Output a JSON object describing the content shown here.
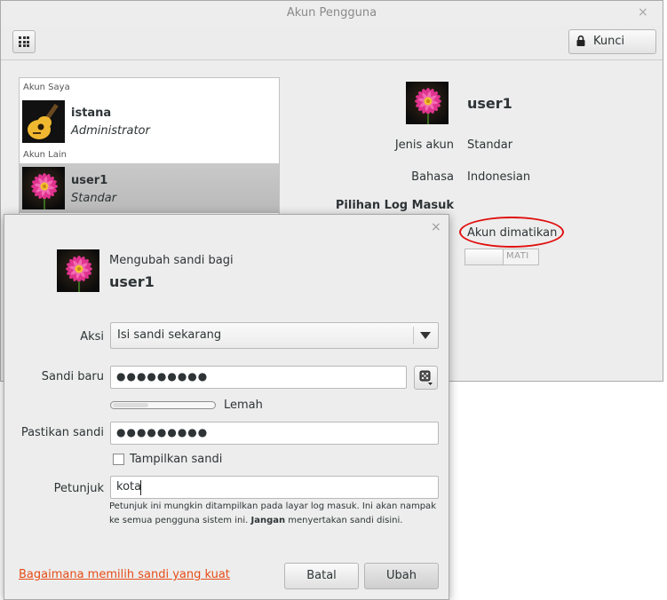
{
  "window": {
    "title": "Akun Pengguna",
    "close_glyph": "×",
    "apps_icon": "app-grid-icon",
    "lock_button": {
      "label": "Kunci",
      "icon": "padlock-icon"
    }
  },
  "user_list": {
    "my_account_header": "Akun Saya",
    "other_accounts_header": "Akun Lain",
    "users": [
      {
        "name": "istana",
        "role": "Administrator",
        "avatar": "guitar-avatar-icon",
        "selected": false
      },
      {
        "name": "user1",
        "role": "Standar",
        "avatar": "flower-avatar-icon",
        "selected": true
      }
    ]
  },
  "details": {
    "username": "user1",
    "account_type_label": "Jenis akun",
    "account_type_value": "Standar",
    "language_label": "Bahasa",
    "language_value": "Indonesian",
    "login_options_label": "Pilihan Log Masuk",
    "password_value": "Akun dimatikan",
    "auto_login_switch": "MATI",
    "annotation_color": "#e10f0f"
  },
  "dialog": {
    "close_glyph": "×",
    "heading": "Mengubah sandi bagi",
    "username": "user1",
    "action_label": "Aksi",
    "action_value": "Isi sandi sekarang",
    "new_password_label": "Sandi baru",
    "new_password_value": "●●●●●●●●●",
    "strength_label": "Lemah",
    "strength_fraction": 0.35,
    "confirm_password_label": "Pastikan sandi",
    "confirm_password_value": "●●●●●●●●●",
    "show_password_label": "Tampilkan sandi",
    "show_password_checked": false,
    "hint_label": "Petunjuk",
    "hint_value": "kota",
    "hint_help_1": "Petunjuk ini mungkin ditampilkan pada layar log masuk. Ini akan nampak ke semua pengguna sistem ini. ",
    "hint_help_bold": "Jangan",
    "hint_help_2": " menyertakan sandi disini.",
    "help_link": "Bagaimana memilih sandi yang kuat",
    "cancel_button": "Batal",
    "change_button": "Ubah",
    "link_color": "#e74c17"
  }
}
